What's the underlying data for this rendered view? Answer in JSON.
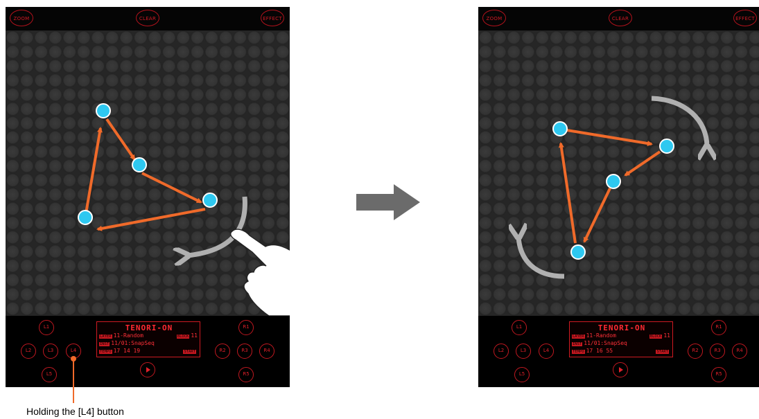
{
  "panels": [
    {
      "id": "before",
      "top_buttons": {
        "zoom": "ZOOM",
        "clear": "CLEAR",
        "effect": "EFFECT"
      },
      "lcd": {
        "title": "TENORI-ON",
        "layer_tag": "LAYER",
        "layer_value": "11-Random",
        "block_tag": "BLOCK",
        "block_value": "11",
        "inst_tag": "INST",
        "inst_value": "11/01:SnapSeq",
        "tempo_tag": "TEMPO",
        "tempo_value": "17 14 19",
        "start_tag": "START"
      },
      "buttons": [
        "L1",
        "L2",
        "L3",
        "L4",
        "L5",
        "R1",
        "R2",
        "R3",
        "R4",
        "R5"
      ]
    },
    {
      "id": "after",
      "top_buttons": {
        "zoom": "ZOOM",
        "clear": "CLEAR",
        "effect": "EFFECT"
      },
      "lcd": {
        "title": "TENORI-ON",
        "layer_tag": "LAYER",
        "layer_value": "11-Random",
        "block_tag": "BLOCK",
        "block_value": "11",
        "inst_tag": "INST",
        "inst_value": "11/01:SnapSeq",
        "tempo_tag": "TEMPO",
        "tempo_value": "17 16 55",
        "start_tag": "START"
      },
      "buttons": [
        "L1",
        "L2",
        "L3",
        "L4",
        "L5",
        "R1",
        "R2",
        "R3",
        "R4",
        "R5"
      ]
    }
  ],
  "caption": "Holding the [L4] button",
  "colors": {
    "node": "#2ec8f0",
    "arrow": "#f06a2a",
    "button_red": "#c01820",
    "grid_bg": "#262626",
    "rotate_arrow": "#b0b0b0"
  }
}
